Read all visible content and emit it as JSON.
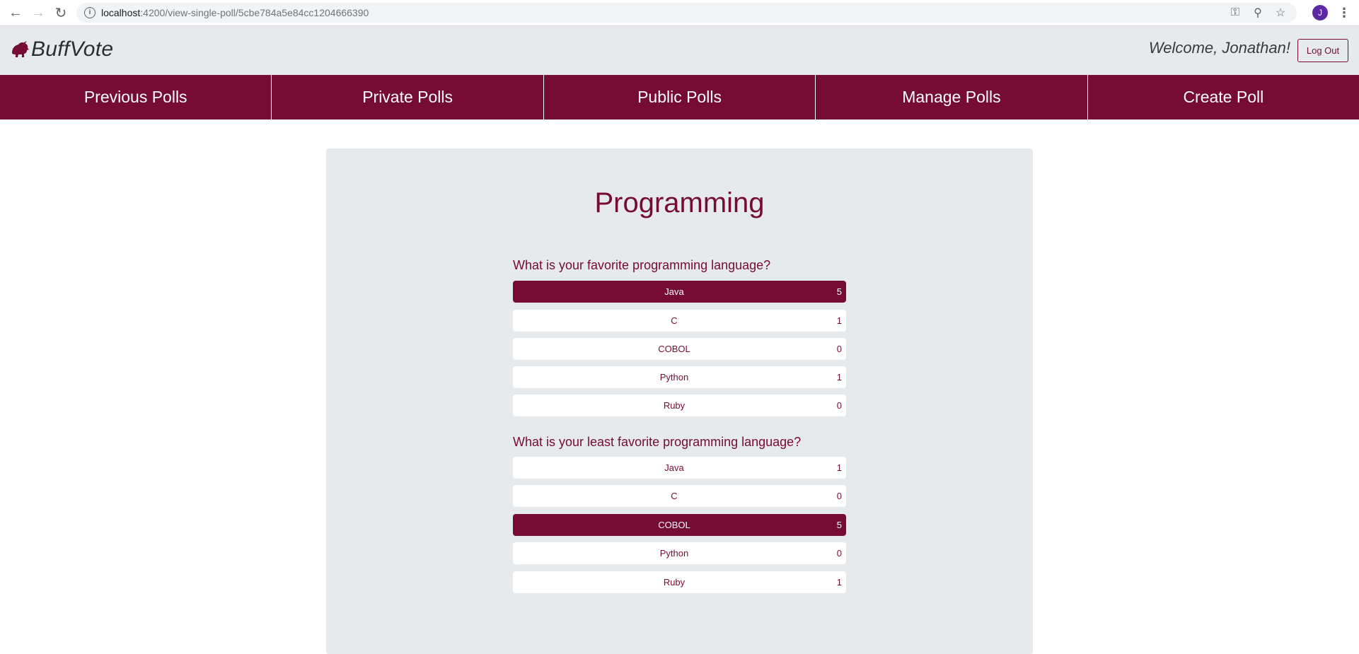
{
  "browser": {
    "url_host": "localhost",
    "url_path": ":4200/view-single-poll/5cbe784a5e84cc1204666390",
    "avatar_letter": "J"
  },
  "header": {
    "brand": "BuffVote",
    "welcome": "Welcome, Jonathan!",
    "logout_label": "Log Out"
  },
  "tabs": [
    {
      "label": "Previous Polls"
    },
    {
      "label": "Private Polls"
    },
    {
      "label": "Public Polls"
    },
    {
      "label": "Manage Polls"
    },
    {
      "label": "Create Poll"
    }
  ],
  "poll": {
    "title": "Programming",
    "questions": [
      {
        "text": "What is your favorite programming language?",
        "options": [
          {
            "label": "Java",
            "count": "5",
            "selected": true
          },
          {
            "label": "C",
            "count": "1",
            "selected": false
          },
          {
            "label": "COBOL",
            "count": "0",
            "selected": false
          },
          {
            "label": "Python",
            "count": "1",
            "selected": false
          },
          {
            "label": "Ruby",
            "count": "0",
            "selected": false
          }
        ]
      },
      {
        "text": "What is your least favorite programming language?",
        "options": [
          {
            "label": "Java",
            "count": "1",
            "selected": false
          },
          {
            "label": "C",
            "count": "0",
            "selected": false
          },
          {
            "label": "COBOL",
            "count": "5",
            "selected": true
          },
          {
            "label": "Python",
            "count": "0",
            "selected": false
          },
          {
            "label": "Ruby",
            "count": "1",
            "selected": false
          }
        ]
      }
    ]
  },
  "colors": {
    "brand": "#760b33",
    "panel": "#e7eaed"
  }
}
